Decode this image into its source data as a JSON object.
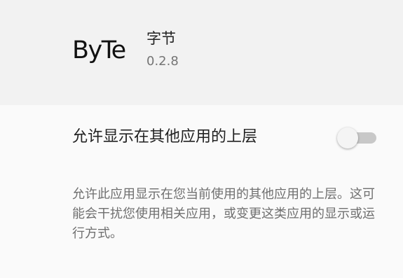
{
  "app": {
    "logo_text": "ByTe",
    "name": "字节",
    "version": "0.2.8"
  },
  "setting": {
    "title": "允许显示在其他应用的上层",
    "enabled": false,
    "description": "允许此应用显示在您当前使用的其他应用的上层。这可能会干扰您使用相关应用，或变更这类应用的显示或运行方式。"
  },
  "colors": {
    "header_bg": "#f2f2f2",
    "page_bg": "#fafafa",
    "toggle_track_off": "#c8c8c8",
    "toggle_thumb_off": "#f4f4f4"
  }
}
